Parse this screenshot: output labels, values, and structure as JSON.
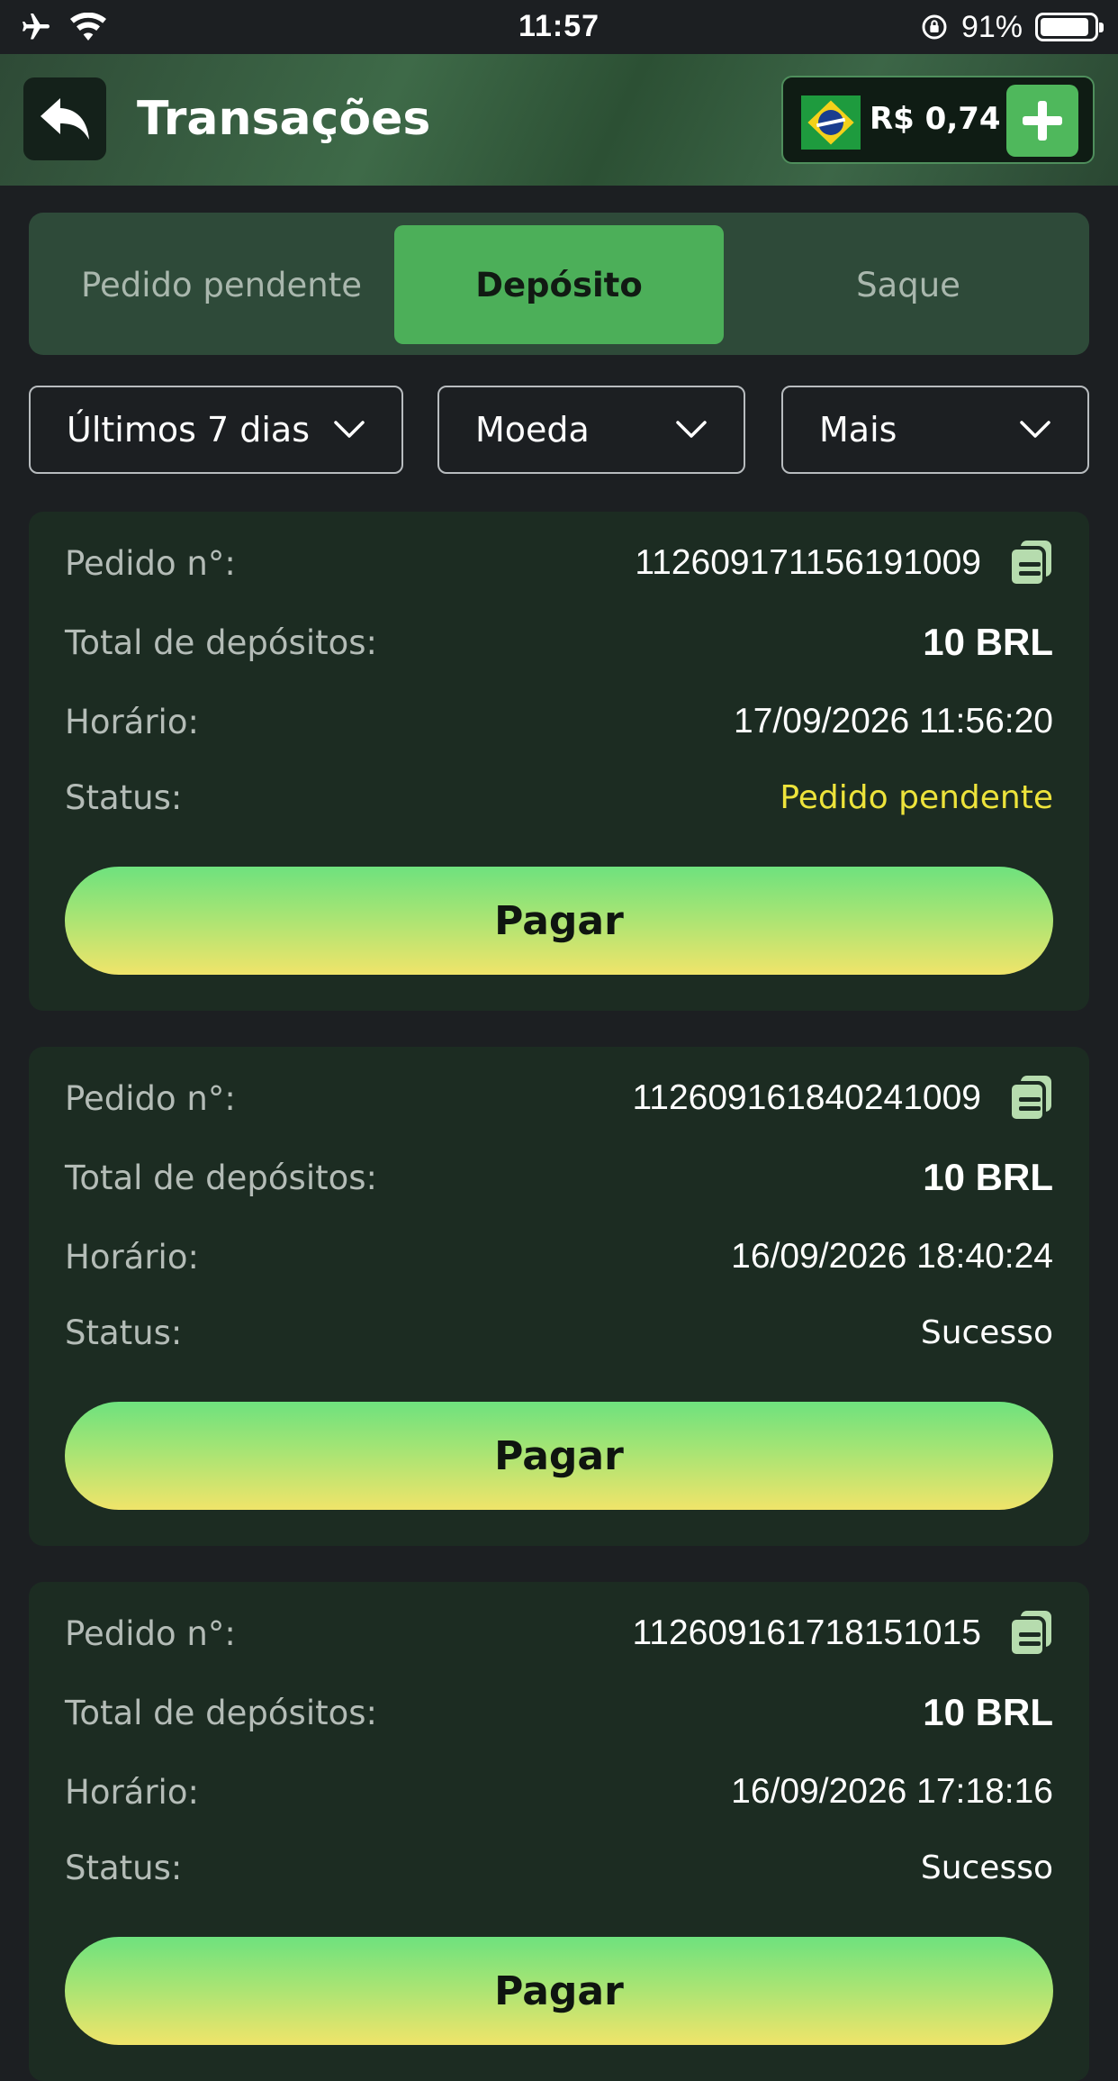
{
  "status_bar": {
    "time": "11:57",
    "battery": "91%"
  },
  "header": {
    "title": "Transações",
    "balance": "R$ 0,74"
  },
  "tabs": [
    {
      "label": "Pedido pendente",
      "active": false
    },
    {
      "label": "Depósito",
      "active": true
    },
    {
      "label": "Saque",
      "active": false
    }
  ],
  "filters": {
    "period": "Últimos 7 dias",
    "currency": "Moeda",
    "more": "Mais"
  },
  "labels": {
    "order": "Pedido n°:",
    "total": "Total de depósitos:",
    "time": "Horário:",
    "status": "Status:",
    "pay": "Pagar"
  },
  "transactions": [
    {
      "order_no": "112609171156191009",
      "total": "10 BRL",
      "time": "17/09/2026 11:56:20",
      "status": "Pedido pendente"
    },
    {
      "order_no": "112609161840241009",
      "total": "10 BRL",
      "time": "16/09/2026 18:40:24",
      "status": "Sucesso"
    },
    {
      "order_no": "112609161718151015",
      "total": "10 BRL",
      "time": "16/09/2026 17:18:16",
      "status": "Sucesso"
    }
  ],
  "colors": {
    "accent_green": "#4caf59",
    "pending_status": "#ede33b",
    "card_bg": "#1c2c22"
  }
}
